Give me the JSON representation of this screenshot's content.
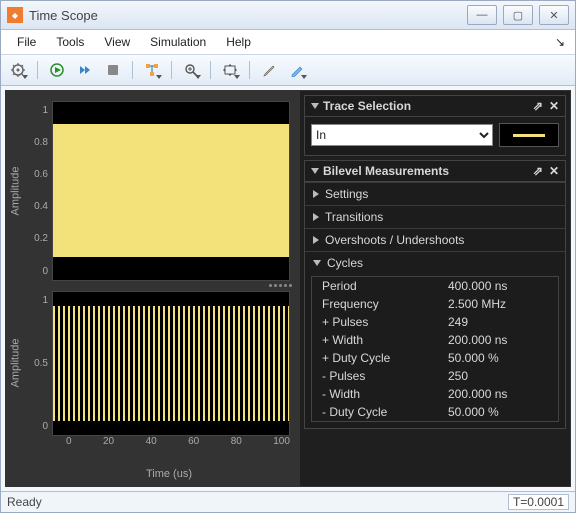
{
  "window": {
    "title": "Time Scope"
  },
  "menu": {
    "items": [
      "File",
      "Tools",
      "View",
      "Simulation",
      "Help"
    ]
  },
  "toolbar": {
    "buttons": [
      {
        "name": "config-button",
        "icon": "gear"
      },
      {
        "name": "run-button",
        "icon": "play"
      },
      {
        "name": "step-button",
        "icon": "step"
      },
      {
        "name": "stop-button",
        "icon": "stop"
      },
      {
        "name": "signal-config-button",
        "icon": "signalcfg"
      },
      {
        "name": "zoom-button",
        "icon": "zoom"
      },
      {
        "name": "scale-button",
        "icon": "scale"
      },
      {
        "name": "highlight-button",
        "icon": "highlight"
      },
      {
        "name": "annotate-button",
        "icon": "annotate"
      }
    ]
  },
  "plots": {
    "ylabel": "Amplitude",
    "xlabel": "Time (us)",
    "yticks_top": [
      "1",
      "0.8",
      "0.6",
      "0.4",
      "0.2",
      "0"
    ],
    "yticks_bottom": [
      "1",
      "0.5",
      "0"
    ],
    "xticks": [
      "0",
      "20",
      "40",
      "60",
      "80",
      "100"
    ]
  },
  "trace": {
    "title": "Trace Selection",
    "options": [
      "In"
    ],
    "selected": "In",
    "color": "#f3e17a"
  },
  "bilevel": {
    "title": "Bilevel Measurements",
    "sections": {
      "settings": "Settings",
      "transitions": "Transitions",
      "overshoots": "Overshoots / Undershoots",
      "cycles": "Cycles"
    },
    "cycles": [
      {
        "k": "Period",
        "v": "400.000 ns"
      },
      {
        "k": "Frequency",
        "v": "2.500 MHz"
      },
      {
        "k": "+ Pulses",
        "v": "249"
      },
      {
        "k": "+ Width",
        "v": "200.000 ns"
      },
      {
        "k": "+ Duty Cycle",
        "v": "50.000 %"
      },
      {
        "k": "- Pulses",
        "v": "250"
      },
      {
        "k": "- Width",
        "v": "200.000 ns"
      },
      {
        "k": "- Duty Cycle",
        "v": "50.000 %"
      }
    ]
  },
  "status": {
    "ready": "Ready",
    "t": "T=0.0001"
  },
  "chart_data": [
    {
      "type": "line",
      "title": "",
      "xlabel": "Time (us)",
      "ylabel": "Amplitude",
      "xlim": [
        0,
        100
      ],
      "ylim": [
        0,
        1
      ],
      "series": [
        {
          "name": "In",
          "description": "2.5 MHz 50% duty-cycle pulse train, amplitude 0–1",
          "period_ns": 400,
          "duty_cycle_pct": 50
        }
      ]
    },
    {
      "type": "line",
      "title": "",
      "xlabel": "Time (us)",
      "ylabel": "Amplitude",
      "xlim": [
        0,
        100
      ],
      "ylim": [
        0,
        1
      ],
      "series": [
        {
          "name": "In",
          "description": "2.5 MHz 50% duty-cycle pulse train, amplitude 0–1",
          "period_ns": 400,
          "duty_cycle_pct": 50
        }
      ]
    }
  ]
}
